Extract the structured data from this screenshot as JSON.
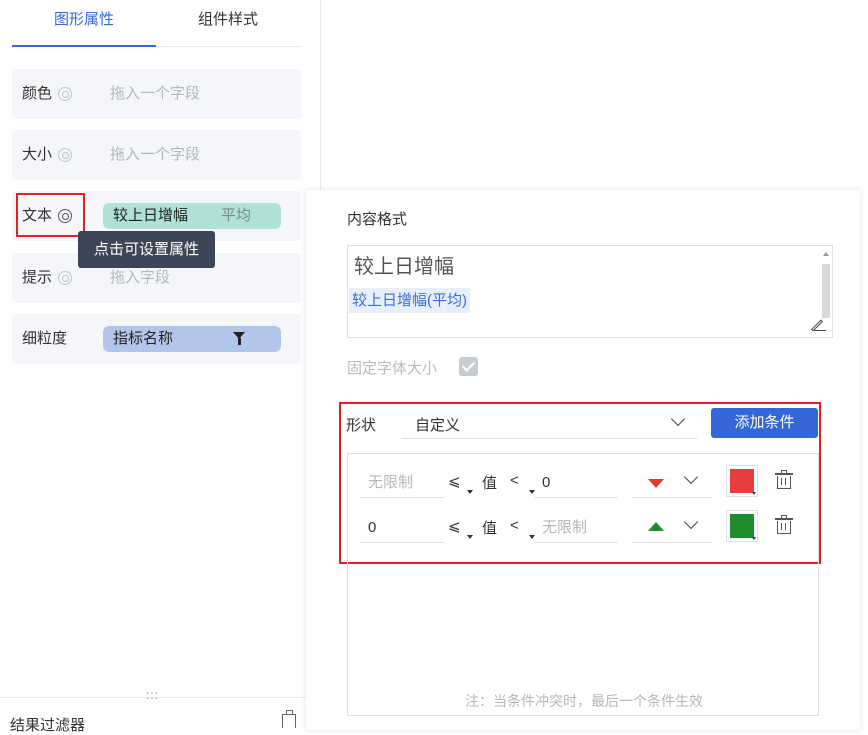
{
  "tabs": [
    {
      "label": "图形属性",
      "active": true
    },
    {
      "label": "组件样式",
      "active": false
    }
  ],
  "fields": {
    "color": {
      "label": "颜色",
      "placeholder": "拖入一个字段"
    },
    "size": {
      "label": "大小",
      "placeholder": "拖入一个字段"
    },
    "text": {
      "label": "文本",
      "pill_name": "较上日增幅",
      "pill_agg": "平均"
    },
    "tip": {
      "label": "提示",
      "placeholder": "拖入字段"
    },
    "granularity": {
      "label": "细粒度",
      "pill_name": "指标名称"
    }
  },
  "tooltip": "点击可设置属性",
  "bottom": {
    "drag_handle": ":::",
    "label": "结果过滤器"
  },
  "popup": {
    "title": "内容格式",
    "editor": {
      "main_text": "较上日增幅",
      "tag": "较上日增幅(平均)"
    },
    "fixed_font_label": "固定字体大小",
    "shape_label": "形状",
    "shape_value": "自定义",
    "add_button": "添加条件",
    "conditions": [
      {
        "min": "无限制",
        "min_is_placeholder": true,
        "op1": "⩽",
        "value_label": "值",
        "op2": "<",
        "max": "0",
        "max_is_placeholder": false,
        "arrow": "down",
        "color": "#e53e3e"
      },
      {
        "min": "0",
        "min_is_placeholder": false,
        "op1": "⩽",
        "value_label": "值",
        "op2": "<",
        "max": "无限制",
        "max_is_placeholder": true,
        "arrow": "up",
        "color": "#1e8c2c"
      }
    ],
    "note": "注：当条件冲突时，最后一个条件生效"
  },
  "colors": {
    "accent": "#3367d6",
    "highlight_border": "#e0202a",
    "pill_teal": "#b1e0d9",
    "pill_blue": "#b3c6ea",
    "tooltip_bg": "#3d4656"
  }
}
